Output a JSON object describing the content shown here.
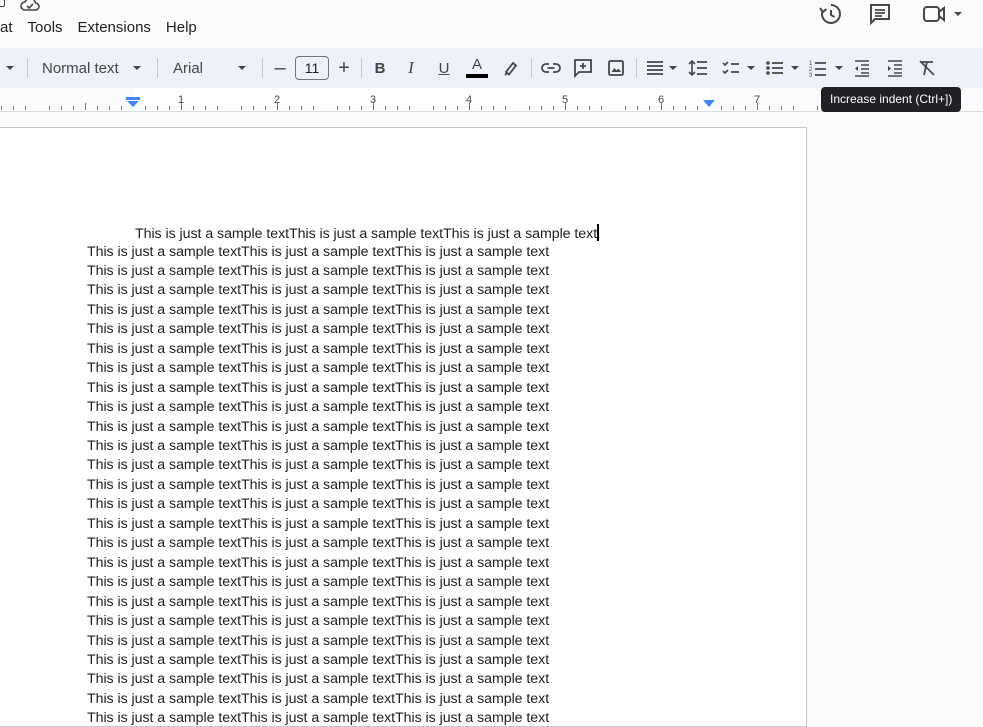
{
  "menu": [
    "at",
    "Tools",
    "Extensions",
    "Help"
  ],
  "toolbar": {
    "style": "Normal text",
    "font": "Arial",
    "font_size": "11",
    "minus": "–",
    "plus": "+",
    "bold": "B",
    "italic": "I",
    "underline": "U",
    "text_color": "A"
  },
  "ruler": {
    "numbers": [
      "1",
      "2",
      "3",
      "4",
      "5",
      "6",
      "7"
    ]
  },
  "tooltip": "Increase indent (Ctrl+])",
  "doc": {
    "first_line": "This is just a sample textThis is just a sample textThis is just a sample text",
    "lines": [
      "This is just a sample textThis is just a sample textThis is just a sample text",
      "This is just a sample textThis is just a sample textThis is just a sample text",
      "This is just a sample textThis is just a sample textThis is just a sample text",
      "This is just a sample textThis is just a sample textThis is just a sample text",
      "This is just a sample textThis is just a sample textThis is just a sample text",
      "This is just a sample textThis is just a sample textThis is just a sample text",
      "This is just a sample textThis is just a sample textThis is just a sample text",
      "This is just a sample textThis is just a sample textThis is just a sample text",
      "This is just a sample textThis is just a sample textThis is just a sample text",
      "This is just a sample textThis is just a sample textThis is just a sample text",
      "This is just a sample textThis is just a sample textThis is just a sample text",
      "This is just a sample textThis is just a sample textThis is just a sample text",
      "This is just a sample textThis is just a sample textThis is just a sample text",
      "This is just a sample textThis is just a sample textThis is just a sample text",
      "This is just a sample textThis is just a sample textThis is just a sample text",
      "This is just a sample textThis is just a sample textThis is just a sample text",
      "This is just a sample textThis is just a sample textThis is just a sample text",
      "This is just a sample textThis is just a sample textThis is just a sample text",
      "This is just a sample textThis is just a sample textThis is just a sample text",
      "This is just a sample textThis is just a sample textThis is just a sample text",
      "This is just a sample textThis is just a sample textThis is just a sample text",
      "This is just a sample textThis is just a sample textThis is just a sample text",
      "This is just a sample textThis is just a sample textThis is just a sample text",
      "This is just a sample textThis is just a sample textThis is just a sample text",
      "This is just a sample textThis is just a sample textThis is just a sample text"
    ]
  },
  "colors": {
    "toolbar_bg": "#edf2fa",
    "tooltip_bg": "#202124",
    "indent_marker": "#4285f4"
  },
  "icons": [
    "cloud-done-icon",
    "history-icon",
    "comment-icon",
    "meet-icon",
    "link-icon",
    "add-comment-icon",
    "image-icon",
    "align-icon",
    "line-spacing-icon",
    "checklist-icon",
    "bullet-list-icon",
    "numbered-list-icon",
    "decrease-indent-icon",
    "increase-indent-icon",
    "clear-formatting-icon"
  ]
}
